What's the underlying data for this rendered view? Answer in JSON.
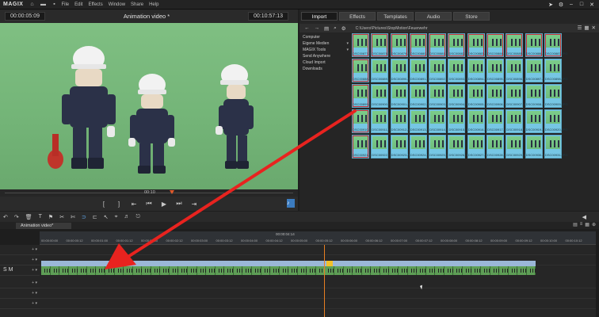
{
  "menubar": {
    "logo": "MAGIX",
    "items": [
      "File",
      "Edit",
      "Effects",
      "Window",
      "Share",
      "Help"
    ]
  },
  "preview": {
    "timecode_left": "00:00:05:09",
    "title": "Animation video *",
    "timecode_right": "00:10:57:13",
    "scrub_time": "00:10"
  },
  "browser": {
    "tabs": [
      "Import",
      "Effects",
      "Templates",
      "Audio",
      "Store"
    ],
    "active_tab": "Import",
    "path": "C:\\Users\\Pictures\\StopMotion\\Feuerwehr",
    "folders": [
      "Computer",
      "Eigene Medien",
      "MAGIX Tools",
      "Send Anywhere",
      "Cloud Import",
      "Downloads"
    ],
    "thumbnails": [
      "DSC00877.JPG",
      "DSC00878.JPG",
      "DSC00879.JPG",
      "DSC00880.JPG",
      "DSC00881.JPG",
      "DSC00882.JPG",
      "DSC00883.JPG",
      "DSC00884.JPG",
      "DSC00885.JPG",
      "DSC00886.JPG",
      "DSC00887.JPG",
      "DSC00888.JPG",
      "DSC00889.JPG",
      "DSC00890.JPG",
      "DSC00891.JPG",
      "DSC00892.JPG",
      "DSC00893.JPG",
      "DSC00894.JPG",
      "DSC00895.JPG",
      "DSC00896.JPG",
      "DSC00897.JPG",
      "DSC00898.JPG",
      "DSC00899.JPG",
      "DSC00900.JPG",
      "DSC00901.JPG",
      "DSC00902.JPG",
      "DSC00903.JPG",
      "DSC00904.JPG",
      "DSC00905.JPG",
      "DSC00906.JPG",
      "DSC00907.JPG",
      "DSC00908.JPG",
      "DSC00909.JPG",
      "DSC00910.JPG",
      "DSC00911.JPG",
      "DSC00912.JPG",
      "DSC00913.JPG",
      "DSC00914.JPG",
      "DSC00915.JPG",
      "DSC00916.JPG",
      "DSC00917.JPG",
      "DSC00918.JPG",
      "DSC00919.JPG",
      "DSC00920.JPG",
      "DSC00921.JPG",
      "DSC00922.JPG",
      "DSC00923.JPG",
      "DSC00924.JPG",
      "DSC00925.JPG",
      "DSC00926.JPG",
      "DSC00927.JPG",
      "DSC00928.JPG",
      "DSC00929.JPG",
      "DSC00930.JPG",
      "DSC00931.JPG"
    ]
  },
  "timeline": {
    "tab_label": "Animation video*",
    "center_time": "00:00:04:14",
    "ruler_labels": [
      "00:00:00:00",
      "00:00:00:12",
      "00:00:01:00",
      "00:00:01:12",
      "00:00:02:00",
      "00:00:02:12",
      "00:00:03:00",
      "00:00:03:12",
      "00:00:04:00",
      "00:00:04:12",
      "00:00:05:00",
      "00:00:05:12",
      "00:00:06:00",
      "00:00:06:12",
      "00:00:07:00",
      "00:00:07:12",
      "00:00:08:00",
      "00:00:08:12",
      "00:00:09:00",
      "00:00:09:12",
      "00:00:10:00",
      "00:00:10:12"
    ],
    "track_sm": "S M",
    "clip_count": 54
  },
  "colors": {
    "accent": "#3b7bbf",
    "arrow": "#e8231f",
    "playhead": "#e67e22",
    "thumbnail_bg": "#76c6e4"
  }
}
